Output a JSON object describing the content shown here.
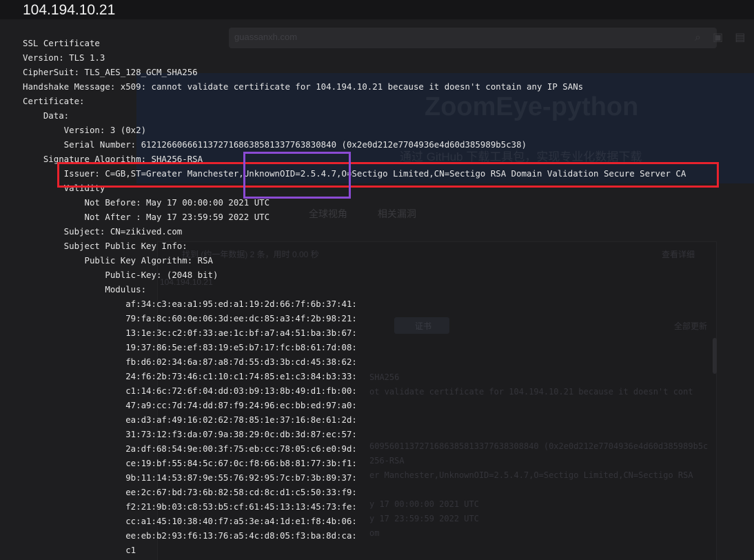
{
  "background": {
    "search_text": "guassanxh.com",
    "search_buttons": "⌕ ▣ ▤",
    "banner_title": "ZoomEye-python",
    "banner_subtitle": "通过 GitHub 下载工具包，实现专业化数据下载",
    "tabs": "全球视角 相关漏洞",
    "result_summary": "找到 (约一年数据) 2 条，用时 0.00 秒",
    "result_ip": "104.194.10.21",
    "right_label": "查看详细",
    "pill_label": "证书",
    "update_label": "全部更新",
    "echo_lines": [
      "SHA256",
      "ot validate certificate for 104.194.10.21 because it doesn't cont",
      "6095601137271686385813377638308840 (0x2e0d212e7704936e4d60d385989b5c",
      "256-RSA",
      "er Manchester,UnknownOID=2.5.4.7,O=Sectigo Limited,CN=Sectigo RSA",
      "y 17 00:00:00 2021 UTC",
      "y 17 23:59:59 2022 UTC",
      "om"
    ]
  },
  "overlay": {
    "ip": "104.194.10.21",
    "cert_lines": [
      "SSL Certificate",
      "Version: TLS 1.3",
      "CipherSuit: TLS_AES_128_GCM_SHA256",
      "Handshake Message: x509: cannot validate certificate for 104.194.10.21 because it doesn't contain any IP SANs",
      "Certificate:",
      "    Data:",
      "        Version: 3 (0x2)",
      "        Serial Number: 61212660666113727168638581337763830840 (0x2e0d212e7704936e4d60d385989b5c38)",
      "    Signature Algorithm: SHA256-RSA",
      "        Issuer: C=GB,ST=Greater Manchester,UnknownOID=2.5.4.7,O=Sectigo Limited,CN=Sectigo RSA Domain Validation Secure Server CA",
      "        Validity",
      "            Not Before: May 17 00:00:00 2021 UTC",
      "            Not After : May 17 23:59:59 2022 UTC",
      "        Subject: CN=zikived.com",
      "        Subject Public Key Info:",
      "            Public Key Algorithm: RSA",
      "                Public-Key: (2048 bit)",
      "                Modulus:",
      "                    af:34:c3:ea:a1:95:ed:a1:19:2d:66:7f:6b:37:41:",
      "                    79:fa:8c:60:0e:06:3d:ee:dc:85:a3:4f:2b:98:21:",
      "                    13:1e:3c:c2:0f:33:ae:1c:bf:a7:a4:51:ba:3b:67:",
      "                    19:37:86:5e:ef:83:19:e5:b7:17:fc:b8:61:7d:08:",
      "                    fb:d6:02:34:6a:87:a8:7d:55:d3:3b:cd:45:38:62:",
      "                    24:f6:2b:73:46:c1:10:c1:74:85:e1:c3:84:b3:33:",
      "                    c1:14:6c:72:6f:04:dd:03:b9:13:8b:49:d1:fb:00:",
      "                    47:a9:cc:7d:74:dd:87:f9:24:96:ec:bb:ed:97:a0:",
      "                    ea:d3:af:49:16:02:62:78:85:1e:37:16:8e:61:2d:",
      "                    31:73:12:f3:da:07:9a:38:29:0c:db:3d:87:ec:57:",
      "                    2a:df:68:54:9e:00:3f:75:eb:cc:78:05:c6:e0:9d:",
      "                    ce:19:bf:55:84:5c:67:0c:f8:66:b8:81:77:3b:f1:",
      "                    9b:11:14:53:87:9e:55:76:92:95:7c:b7:3b:89:37:",
      "                    ee:2c:67:bd:73:6b:82:58:cd:8c:d1:c5:50:33:f9:",
      "                    f2:21:9b:03:c8:53:b5:cf:61:45:13:13:45:73:fe:",
      "                    cc:a1:45:10:38:40:f7:a5:3e:a4:1d:e1:f8:4b:06:",
      "                    ee:eb:b2:93:f6:13:76:a5:4c:d8:05:f3:ba:8d:ca:",
      "                    c1"
    ]
  },
  "annotations": {
    "red": "#e8222d",
    "purple": "#8b4bd4"
  }
}
